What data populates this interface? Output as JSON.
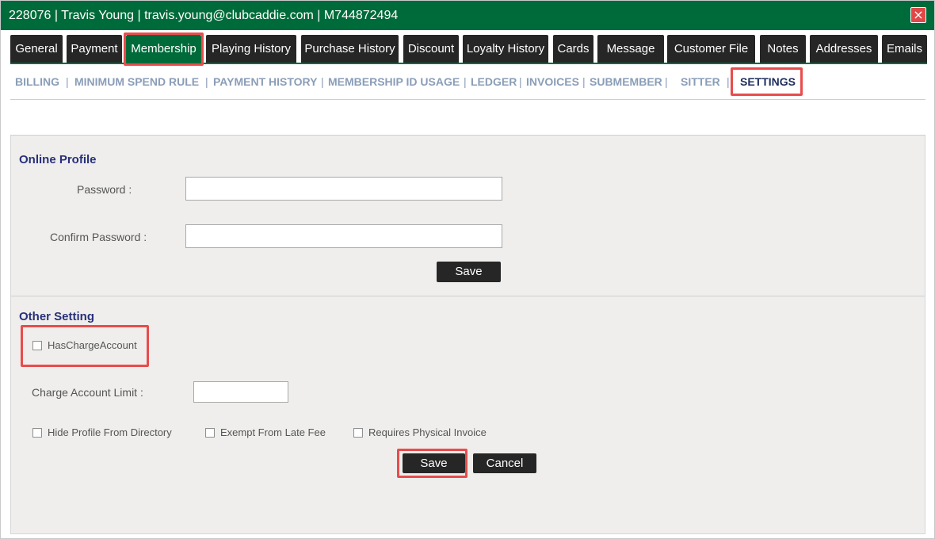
{
  "window": {
    "title": "228076 | Travis Young | travis.young@clubcaddie.com | M744872494",
    "close_glyph": "×"
  },
  "tabs": [
    {
      "label": "General"
    },
    {
      "label": "Payment"
    },
    {
      "label": "Membership",
      "active": true
    },
    {
      "label": "Playing History"
    },
    {
      "label": "Purchase History"
    },
    {
      "label": "Discount"
    },
    {
      "label": "Loyalty History"
    },
    {
      "label": "Cards"
    },
    {
      "label": "Message"
    },
    {
      "label": "Customer File"
    },
    {
      "label": "Notes"
    },
    {
      "label": "Addresses"
    },
    {
      "label": "Emails"
    }
  ],
  "subnav": {
    "separator": "|",
    "items": [
      {
        "label": "BILLING"
      },
      {
        "label": "MINIMUM SPEND RULE"
      },
      {
        "label": "PAYMENT HISTORY"
      },
      {
        "label": "MEMBERSHIP ID USAGE"
      },
      {
        "label": "LEDGER"
      },
      {
        "label": "INVOICES"
      },
      {
        "label": "SUBMEMBER"
      },
      {
        "label": "SITTER"
      },
      {
        "label": "SETTINGS",
        "active": true
      }
    ]
  },
  "online_profile": {
    "title": "Online Profile",
    "password_label": "Password :",
    "password_value": "",
    "confirm_label": "Confirm Password :",
    "confirm_value": "",
    "save_label": "Save"
  },
  "other_setting": {
    "title": "Other Setting",
    "has_charge_account_label": "HasChargeAccount",
    "has_charge_account_checked": false,
    "charge_limit_label": "Charge Account Limit :",
    "charge_limit_value": "",
    "hide_profile_label": "Hide Profile From Directory",
    "exempt_late_fee_label": "Exempt From Late Fee",
    "requires_invoice_label": "Requires Physical Invoice",
    "save_label": "Save",
    "cancel_label": "Cancel"
  },
  "colors": {
    "brand_green": "#006b3a",
    "tab_dark": "#262626",
    "highlight_red": "#e84c4c",
    "section_title": "#27307a",
    "subnav_link": "#8a9db8",
    "subnav_active": "#1d2d5c"
  }
}
